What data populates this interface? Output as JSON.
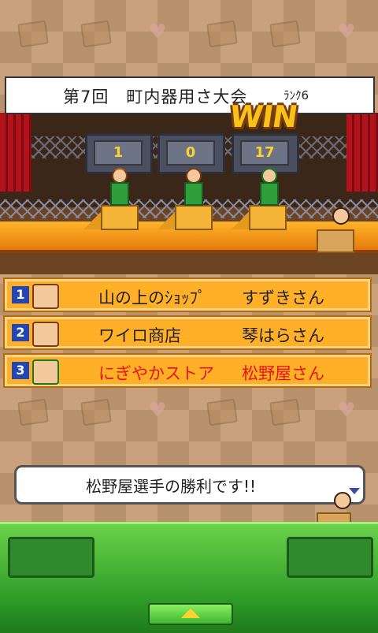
{
  "header": {
    "title": "第7回　町内器用さ大会",
    "rank": "ﾗﾝｸ6",
    "win_label": "WIN"
  },
  "scores": [
    "1",
    "0",
    "17"
  ],
  "ranking": [
    {
      "place": "1",
      "shop": "山の上のｼｮｯﾌﾟ",
      "owner": "すずきさん",
      "highlight": false
    },
    {
      "place": "2",
      "shop": "ワイロ商店",
      "owner": "琴はらさん",
      "highlight": false
    },
    {
      "place": "3",
      "shop": "にぎやかストア",
      "owner": "松野屋さん",
      "highlight": true
    }
  ],
  "message": "松野屋選手の勝利です!!",
  "colors": {
    "row_bg": "#ffb027",
    "highlight_text": "#e8141c",
    "panel_green": "#2e9b27"
  }
}
